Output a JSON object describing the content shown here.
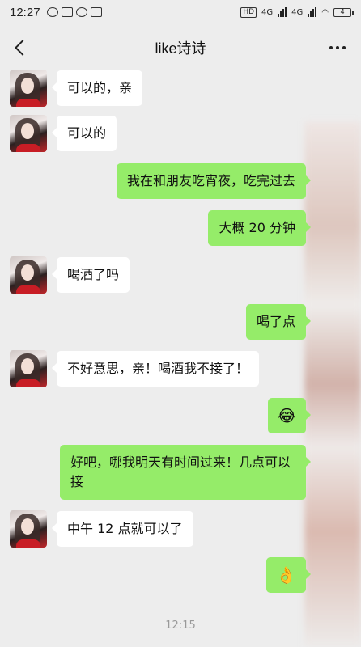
{
  "status_bar": {
    "time": "12:27",
    "network_labels": [
      "HD",
      "4G",
      "4G"
    ],
    "battery": "4"
  },
  "header": {
    "title": "like诗诗"
  },
  "messages": [
    {
      "side": "left",
      "text": "可以的，亲"
    },
    {
      "side": "left",
      "text": "可以的"
    },
    {
      "side": "right",
      "text": "我在和朋友吃宵夜，吃完过去"
    },
    {
      "side": "right",
      "text": "大概 20 分钟"
    },
    {
      "side": "left",
      "text": "喝酒了吗"
    },
    {
      "side": "right",
      "text": "喝了点"
    },
    {
      "side": "left",
      "text": "不好意思，亲！喝酒我不接了！"
    },
    {
      "side": "right",
      "text": "😂"
    },
    {
      "side": "right",
      "text": "好吧，哪我明天有时间过来！几点可以接"
    },
    {
      "side": "left",
      "text": "中午 12 点就可以了"
    },
    {
      "side": "right",
      "text": "👌"
    }
  ],
  "timestamp": "12:15"
}
